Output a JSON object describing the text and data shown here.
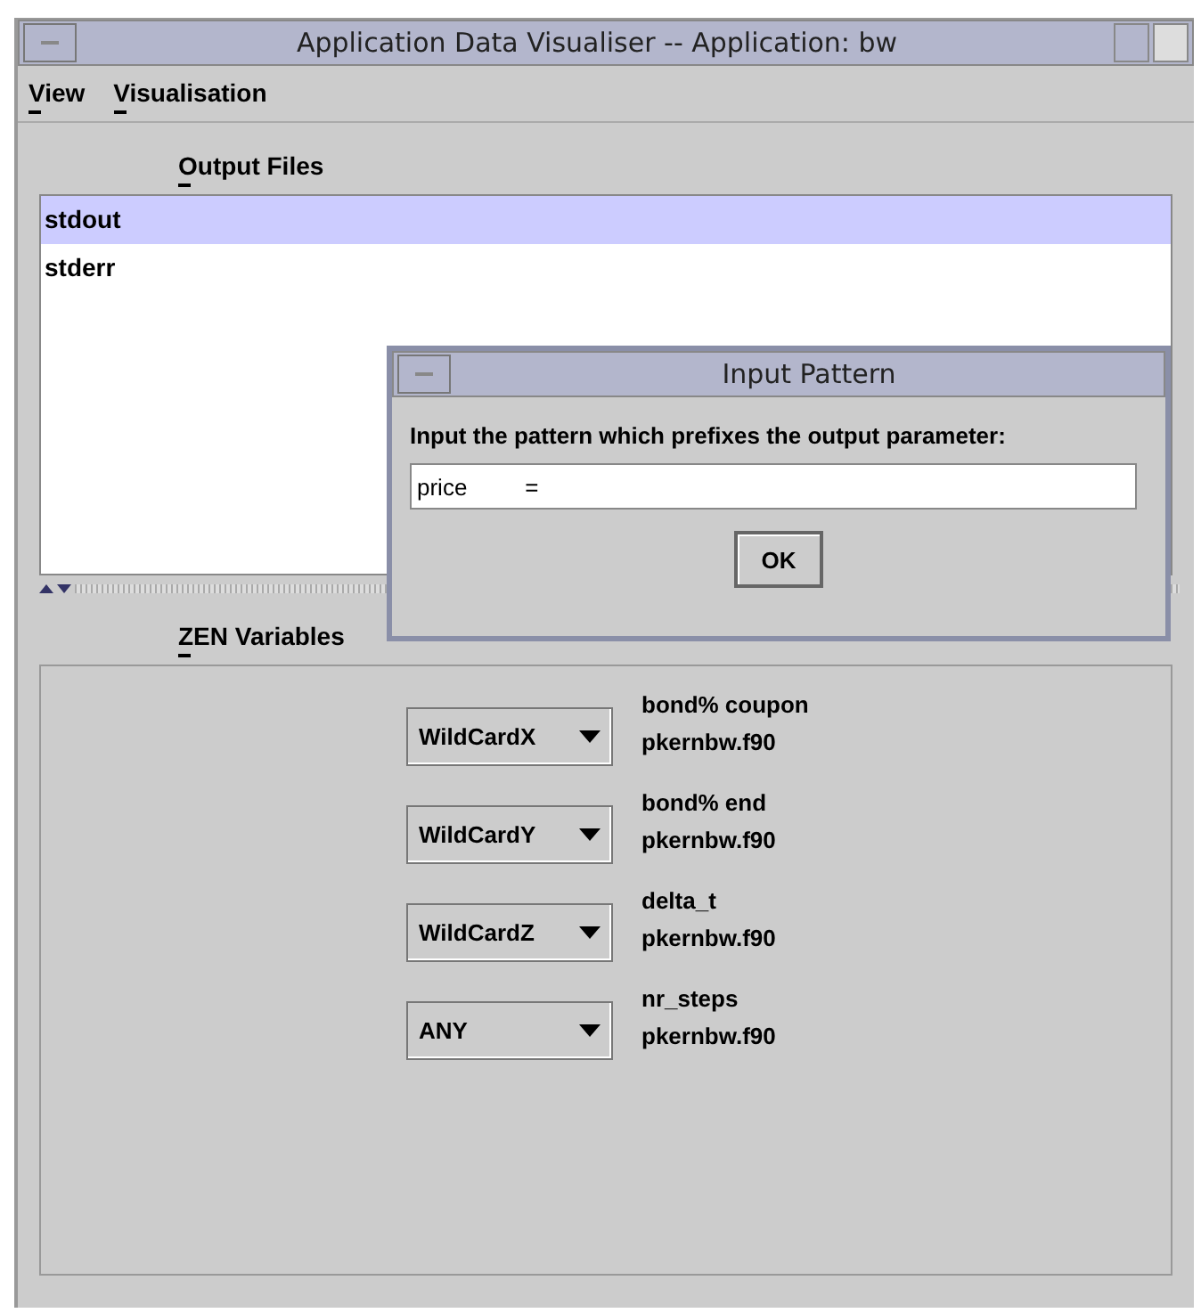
{
  "window": {
    "title": "Application Data Visualiser -- Application: bw"
  },
  "menu": [
    {
      "label": "View"
    },
    {
      "label": "Visualisation"
    }
  ],
  "output_files": {
    "label": "Output Files",
    "items": [
      {
        "name": "stdout",
        "selected": true
      },
      {
        "name": "stderr",
        "selected": false
      }
    ]
  },
  "dialog": {
    "title": "Input Pattern",
    "prompt": "Input the pattern which prefixes the output parameter:",
    "value": "price         =",
    "button": "OK"
  },
  "zen_variables": {
    "label": "ZEN Variables",
    "rows": [
      {
        "choice": "WildCardX",
        "variable": "bond% coupon",
        "file": "pkernbw.f90"
      },
      {
        "choice": "WildCardY",
        "variable": "bond% end",
        "file": "pkernbw.f90"
      },
      {
        "choice": "WildCardZ",
        "variable": "delta_t",
        "file": "pkernbw.f90"
      },
      {
        "choice": "ANY",
        "variable": "nr_steps",
        "file": "pkernbw.f90"
      }
    ]
  }
}
